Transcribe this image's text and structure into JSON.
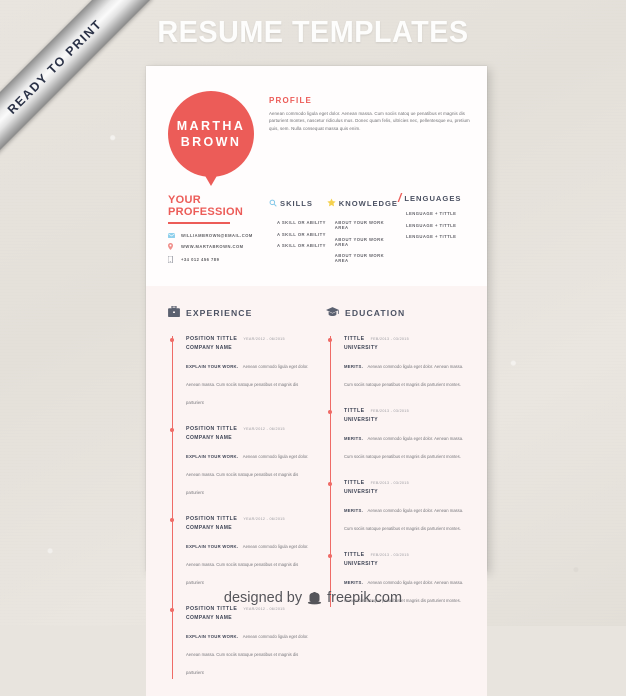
{
  "banner": {
    "title": "RESUME TEMPLATES",
    "ribbon_label": "READY TO PRINT"
  },
  "footer": {
    "designed_by": "designed by",
    "brand": "freepik.com",
    "logo_icon": "freepik-hat-icon"
  },
  "resume": {
    "name_line1": "MARTHA",
    "name_line2": "BROWN",
    "profile": {
      "heading": "PROFILE",
      "text": "Aenean commodo ligula eget dolor. Aenean massa. Cum sociis natoq ue penatibus et magnis dis parturient montes, nascetur ridiculus mus. Donec quam felis, ultricies nec, pellentesque eu, pretium quis, sem. Nulla consequat massa quis enim."
    },
    "profession": "YOUR PROFESSION",
    "contacts": [
      {
        "icon": "envelope-icon",
        "text": "WILLIAMBROWN@EMAIL.COM"
      },
      {
        "icon": "location-pin-icon",
        "text": "WWW.MARTABROWN.COM"
      },
      {
        "icon": "mobile-phone-icon",
        "text": "+34 012 456 789"
      }
    ],
    "columns": [
      {
        "icon": "magnifier-icon",
        "title": "SKILLS",
        "items": [
          "A SKILL OR ABILITY",
          "A SKILL OR ABILITY",
          "A SKILL OR ABILITY"
        ]
      },
      {
        "icon": "star-icon",
        "title": "KNOWLEDGE",
        "items": [
          "ABOUT YOUR WORK AREA",
          "ABOUT YOUR WORK AREA",
          "ABOUT YOUR WORK AREA"
        ]
      },
      {
        "icon": "slash-icon",
        "title": "LENGUAGES",
        "items": [
          "LENGUAGE + TITTLE",
          "LENGUAGE + TITTLE",
          "LENGUAGE + TITTLE"
        ]
      }
    ],
    "experience": {
      "icon": "briefcase-icon",
      "title": "EXPERIENCE",
      "entries": [
        {
          "title": "POSITION TITTLE",
          "date": "YEAR/2012 - 06/2015",
          "subtitle": "COMPANY NAME",
          "lead": "EXPLAIN YOUR WORK.",
          "text": "Aenean commodo ligula eget dolor. Aenean massa. Cum sociis natoque penatibus et magnis dis parturient"
        },
        {
          "title": "POSITION TITTLE",
          "date": "YEAR/2012 - 06/2015",
          "subtitle": "COMPANY NAME",
          "lead": "EXPLAIN YOUR WORK.",
          "text": "Aenean commodo ligula eget dolor. Aenean massa. Cum sociis natoque penatibus et magnis dis parturient"
        },
        {
          "title": "POSITION TITTLE",
          "date": "YEAR/2012 - 06/2015",
          "subtitle": "COMPANY NAME",
          "lead": "EXPLAIN YOUR WORK.",
          "text": "Aenean commodo ligula eget dolor. Aenean massa. Cum sociis natoque penatibus et magnis dis parturient"
        },
        {
          "title": "POSITION TITTLE",
          "date": "YEAR/2012 - 06/2015",
          "subtitle": "COMPANY NAME",
          "lead": "EXPLAIN YOUR WORK.",
          "text": "Aenean commodo ligula eget dolor. Aenean massa. Cum sociis natoque penatibus et magnis dis parturient"
        }
      ]
    },
    "education": {
      "icon": "graduation-cap-icon",
      "title": "EDUCATION",
      "entries": [
        {
          "title": "TITTLE",
          "date": "FEB/2013 - 03/2015",
          "subtitle": "UNIVERSITY",
          "lead": "MERITS.",
          "text": "Aenean commodo ligula eget dolor. Aenean massa. Cum sociis natoque penatibus et magnis dis parturient montes."
        },
        {
          "title": "TITTLE",
          "date": "FEB/2013 - 03/2015",
          "subtitle": "UNIVERSITY",
          "lead": "MERITS.",
          "text": "Aenean commodo ligula eget dolor. Aenean massa. Cum sociis natoque penatibus et magnis dis parturient montes."
        },
        {
          "title": "TITTLE",
          "date": "FEB/2013 - 03/2015",
          "subtitle": "UNIVERSITY",
          "lead": "MERITS.",
          "text": "Aenean commodo ligula eget dolor. Aenean massa. Cum sociis natoque penatibus et magnis dis parturient montes."
        },
        {
          "title": "TITTLE",
          "date": "FEB/2013 - 03/2015",
          "subtitle": "UNIVERSITY",
          "lead": "MERITS.",
          "text": "Aenean commodo ligula eget dolor. Aenean massa. Cum sociis natoque penatibus et magnis dis parturient montes."
        }
      ]
    }
  },
  "colors": {
    "accent_red": "#ec5c58",
    "timeline_red": "#ef6b66",
    "dark_navy": "#3e4455",
    "heading_slate": "#4c5263",
    "skills_blue": "#7fc6e8",
    "star_yellow": "#f5d14e",
    "sheet_white": "#fffdfd",
    "sheet_pink": "#fcf4f3",
    "canvas": "#e8e4de"
  }
}
